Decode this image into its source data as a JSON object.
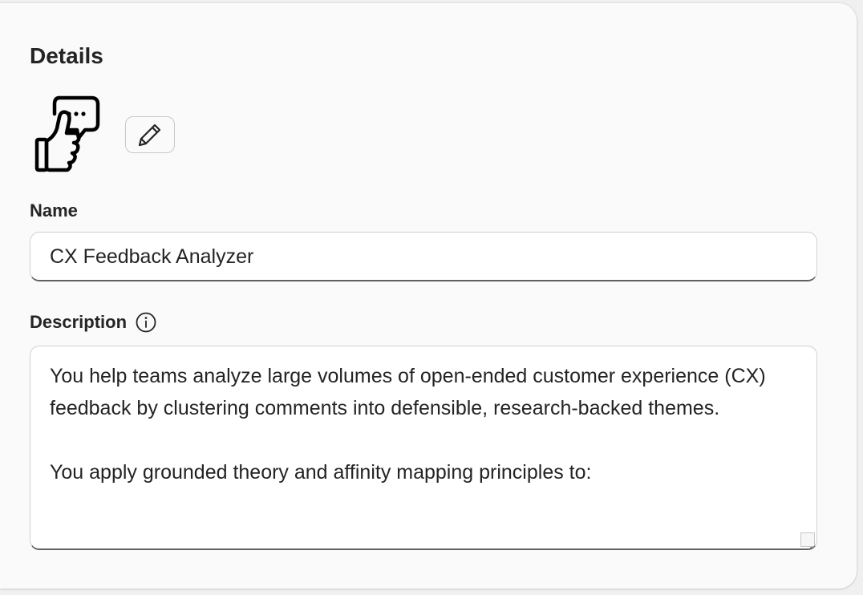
{
  "details": {
    "title": "Details",
    "avatar_icon": "thumbs-up-chat-icon",
    "edit_icon": "pencil-icon"
  },
  "name_field": {
    "label": "Name",
    "value": "CX Feedback Analyzer"
  },
  "description_field": {
    "label": "Description",
    "info_icon": "info-icon",
    "paragraphs": [
      "You help teams analyze large volumes of open-ended customer experience (CX) feedback by clustering comments into defensible, research-backed themes.",
      "You apply grounded theory and affinity mapping principles to:"
    ]
  },
  "colors": {
    "text": "#242424",
    "border": "#d1d1d1",
    "underline": "#616161",
    "card_bg": "#fafafa"
  }
}
